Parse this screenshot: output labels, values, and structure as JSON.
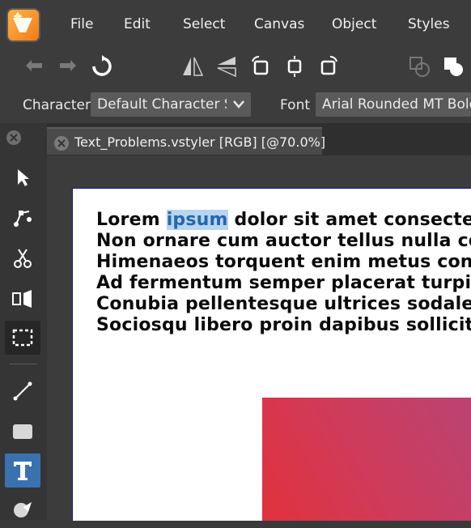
{
  "menubar": {
    "items": [
      "File",
      "Edit",
      "Select",
      "Canvas",
      "Object",
      "Styles"
    ]
  },
  "toolbar": {
    "buttons": [
      "undo-icon",
      "redo-icon",
      "refresh-icon",
      "flip-horizontal-icon",
      "flip-vertical-icon",
      "rotate-left-icon",
      "rotate-both-icon",
      "rotate-right-icon",
      "boolean-union-icon",
      "shape-fill-icon"
    ]
  },
  "context_bar": {
    "character_label": "Character",
    "character_style": "Default Character St",
    "font_label": "Font",
    "font_value": "Arial Rounded MT Bold"
  },
  "tools": {
    "items": [
      "select-arrow-icon",
      "node-edit-icon",
      "scissors-icon",
      "transform-icon",
      "marquee-select-icon",
      "line-tool-icon",
      "rectangle-tool-icon",
      "text-tool-icon",
      "shape-builder-icon"
    ]
  },
  "document": {
    "tab_title": "Text_Problems.vstyler [RGB] [@70.0%]",
    "lines": [
      {
        "before": "Lorem ",
        "highlight": "ipsum",
        "after": " dolor sit amet consectetur"
      },
      {
        "before": "Non ornare cum auctor tellus nulla congue",
        "highlight": "",
        "after": ""
      },
      {
        "before": "Himenaeos torquent enim metus consectetur",
        "highlight": "",
        "after": ""
      },
      {
        "before": "Ad fermentum semper placerat turpis",
        "highlight": "",
        "after": ""
      },
      {
        "before": "Conubia pellentesque ultrices sodales",
        "highlight": "",
        "after": ""
      },
      {
        "before": "Sociosqu libero proin dapibus sollicitudin",
        "highlight": "",
        "after": ""
      }
    ]
  },
  "colors": {
    "accent": "#3a72b0",
    "highlight": "#b8d5ef",
    "gradient_start": "#e3313a",
    "gradient_end": "#b54578"
  }
}
